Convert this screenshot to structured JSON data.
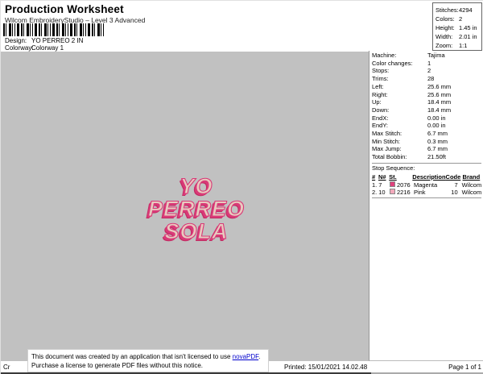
{
  "header": {
    "title": "Production Worksheet",
    "subtitle": "Wilcom EmbroideryStudio – Level 3 Advanced",
    "design_label": "Design:",
    "design_value": "YO PERREO 2 IN",
    "colorway_label": "Colorway:",
    "colorway_value": "Colorway 1"
  },
  "stats_box": {
    "rows": [
      {
        "label": "Stitches:",
        "value": "4294"
      },
      {
        "label": "Colors:",
        "value": "2"
      },
      {
        "label": "Height:",
        "value": "1.45 in"
      },
      {
        "label": "Width:",
        "value": "2.01 in"
      },
      {
        "label": "Zoom:",
        "value": "1:1"
      }
    ]
  },
  "machine_panel": {
    "rows": [
      {
        "label": "Machine:",
        "value": "Tajima"
      },
      {
        "label": "Color changes:",
        "value": "1"
      },
      {
        "label": "Stops:",
        "value": "2"
      },
      {
        "label": "Trims:",
        "value": "28"
      },
      {
        "label": "Left:",
        "value": "25.6 mm"
      },
      {
        "label": "Right:",
        "value": "25.6 mm"
      },
      {
        "label": "Up:",
        "value": "18.4 mm"
      },
      {
        "label": "Down:",
        "value": "18.4 mm"
      },
      {
        "label": "EndX:",
        "value": "0.00 in"
      },
      {
        "label": "EndY:",
        "value": "0.00 in"
      },
      {
        "label": "Max Stitch:",
        "value": "6.7 mm"
      },
      {
        "label": "Min Stitch:",
        "value": "0.3 mm"
      },
      {
        "label": "Max Jump:",
        "value": "6.7 mm"
      },
      {
        "label": "Total Bobbin:",
        "value": "21.50ft"
      }
    ],
    "stop_sequence_label": "Stop Sequence:",
    "table": {
      "headers": {
        "num": "#",
        "n": "N#",
        "st": "St.",
        "description": "Description",
        "code": "Code",
        "brand": "Brand"
      },
      "rows": [
        {
          "num": "1.",
          "n": "7",
          "swatch_color": "#e0417d",
          "st": "2076",
          "description": "Magenta",
          "code": "7",
          "brand": "Wilcom"
        },
        {
          "num": "2.",
          "n": "10",
          "swatch_color": "#f2a9bb",
          "st": "2216",
          "description": "Pink",
          "code": "10",
          "brand": "Wilcom"
        }
      ]
    }
  },
  "design_preview": {
    "lines": [
      "YO",
      "PERREO",
      "SOLA"
    ],
    "fill_color": "#e8cabf",
    "outline_color": "#d93a78",
    "canvas_color": "#c1c1c1"
  },
  "notice": {
    "line1_prefix": "This document was created by an application that isn't licensed to use ",
    "link_text": "novaPDF",
    "line1_suffix": ".",
    "line2": "Purchase a license to generate PDF files without this notice."
  },
  "footer": {
    "left_fragment": "Cr",
    "printed": "Printed: 15/01/2021 14.02.48",
    "page": "Page 1 of 1"
  }
}
